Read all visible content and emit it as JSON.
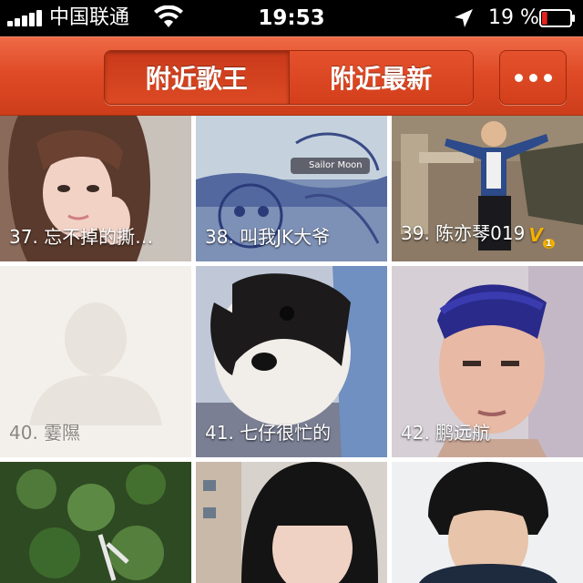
{
  "status_bar": {
    "carrier": "中国联通",
    "time": "19:53",
    "battery_percent": "19 %",
    "battery_level": 0.19,
    "signal_bars": 5,
    "icons": [
      "signal-icon",
      "wifi-icon",
      "location-arrow-icon",
      "battery-icon"
    ]
  },
  "nav": {
    "tabs": [
      {
        "label": "附近歌王",
        "active": true
      },
      {
        "label": "附近最新",
        "active": false
      }
    ],
    "more_icon": "ellipsis-icon"
  },
  "grid": {
    "users": [
      {
        "caption": "37. 忘不掉的撕…",
        "badge": ""
      },
      {
        "caption": "38. 叫我JK大爷",
        "badge": "",
        "overlay_text": "Sailor Moon"
      },
      {
        "caption": "39. 陈亦琴019",
        "badge": "V",
        "badge_level": "1"
      },
      {
        "caption": "40. 霎隰",
        "badge": "",
        "placeholder_avatar": true
      },
      {
        "caption": "41. 七仔很忙的",
        "badge": ""
      },
      {
        "caption": "42. 鹏远航",
        "badge": ""
      },
      {
        "caption": "",
        "badge": ""
      },
      {
        "caption": "",
        "badge": ""
      },
      {
        "caption": "",
        "badge": ""
      }
    ]
  },
  "colors": {
    "nav_red": "#e04a26",
    "nav_dark": "#9e2a0c",
    "vip_gold": "#f4b000",
    "battery_red": "#e0231c"
  }
}
